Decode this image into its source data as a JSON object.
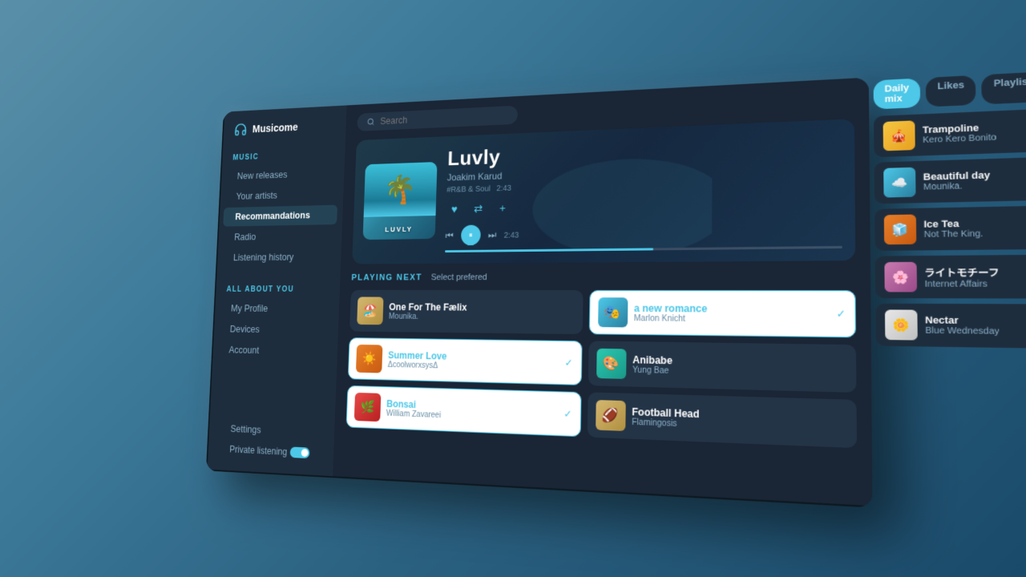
{
  "app": {
    "name": "Musicome",
    "logo_symbol": "🎵"
  },
  "sidebar": {
    "music_label": "MUSIC",
    "music_items": [
      {
        "id": "new-releases",
        "label": "New releases",
        "active": false
      },
      {
        "id": "your-artists",
        "label": "Your artists",
        "active": false
      },
      {
        "id": "recommendations",
        "label": "Recommandations",
        "active": true
      },
      {
        "id": "radio",
        "label": "Radio",
        "active": false
      },
      {
        "id": "listening-history",
        "label": "Listening history",
        "active": false
      }
    ],
    "about_label": "ALL ABOUT YOU",
    "about_items": [
      {
        "id": "my-profile",
        "label": "My Profile",
        "active": false
      },
      {
        "id": "devices",
        "label": "Devices",
        "active": false
      },
      {
        "id": "account",
        "label": "Account",
        "active": false
      }
    ],
    "settings_label": "Settings",
    "private_listening_label": "Private listening"
  },
  "search": {
    "placeholder": "Search"
  },
  "now_playing": {
    "title": "Luvly",
    "artist": "Joakim Karud",
    "genre": "#R&B & Soul",
    "duration": "2:43",
    "current_time": "2:43",
    "album_art_text": "LUVLY",
    "album_art_emoji": "🌴"
  },
  "playing_next": {
    "header": "PLAYING NEXT",
    "subheader": "Select prefered",
    "tracks": [
      {
        "id": "one-for-the-faelix",
        "title": "One For The Fælix",
        "artist": "Mounika.",
        "thumb": "🏖️",
        "thumb_class": "thumb-sand",
        "selected": false,
        "checkmark": false
      },
      {
        "id": "a-new-romance",
        "title": "a new romance",
        "artist": "Marlon Knicht",
        "thumb": "🎭",
        "thumb_class": "thumb-blue",
        "selected": true,
        "checkmark": true
      },
      {
        "id": "summer-love",
        "title": "Summer Love",
        "artist": "ΔcoolworxsysΔ",
        "thumb": "☀️",
        "thumb_class": "thumb-orange",
        "selected": true,
        "checkmark": true
      },
      {
        "id": "anibabe",
        "title": "Anibabe",
        "artist": "Yung Bae",
        "thumb": "🎨",
        "thumb_class": "thumb-teal",
        "selected": false,
        "checkmark": false
      },
      {
        "id": "bonsai",
        "title": "Bonsai",
        "artist": "William Zavareei",
        "thumb": "🌿",
        "thumb_class": "thumb-red",
        "selected": true,
        "checkmark": true
      },
      {
        "id": "football-head",
        "title": "Football Head",
        "artist": "Flamingosis",
        "thumb": "🏈",
        "thumb_class": "thumb-sand",
        "selected": false,
        "checkmark": false
      }
    ]
  },
  "tabs": [
    {
      "id": "daily-mix",
      "label": "Daily mix",
      "active": true
    },
    {
      "id": "likes",
      "label": "Likes",
      "active": false
    },
    {
      "id": "playlists",
      "label": "Playlists",
      "active": false
    }
  ],
  "daily_mix_songs": [
    {
      "id": "trampoline",
      "title": "Trampoline",
      "artist": "Kero Kero Bonito",
      "thumb_class": "thumb-yellow",
      "emoji": "🎪"
    },
    {
      "id": "beautiful-day",
      "title": "Beautiful day",
      "artist": "Mounika.",
      "thumb_class": "thumb-blue",
      "emoji": "☁️"
    },
    {
      "id": "ice-tea",
      "title": "Ice Tea",
      "artist": "Not The King.",
      "thumb_class": "thumb-orange",
      "emoji": "🧊"
    },
    {
      "id": "raito-mochif",
      "title": "ライトモチーフ",
      "artist": "Internet Affairs",
      "thumb_class": "thumb-pink",
      "emoji": "🌸"
    },
    {
      "id": "nectar",
      "title": "Nectar",
      "artist": "Blue Wednesday",
      "thumb_class": "thumb-white",
      "emoji": "🌼"
    }
  ]
}
